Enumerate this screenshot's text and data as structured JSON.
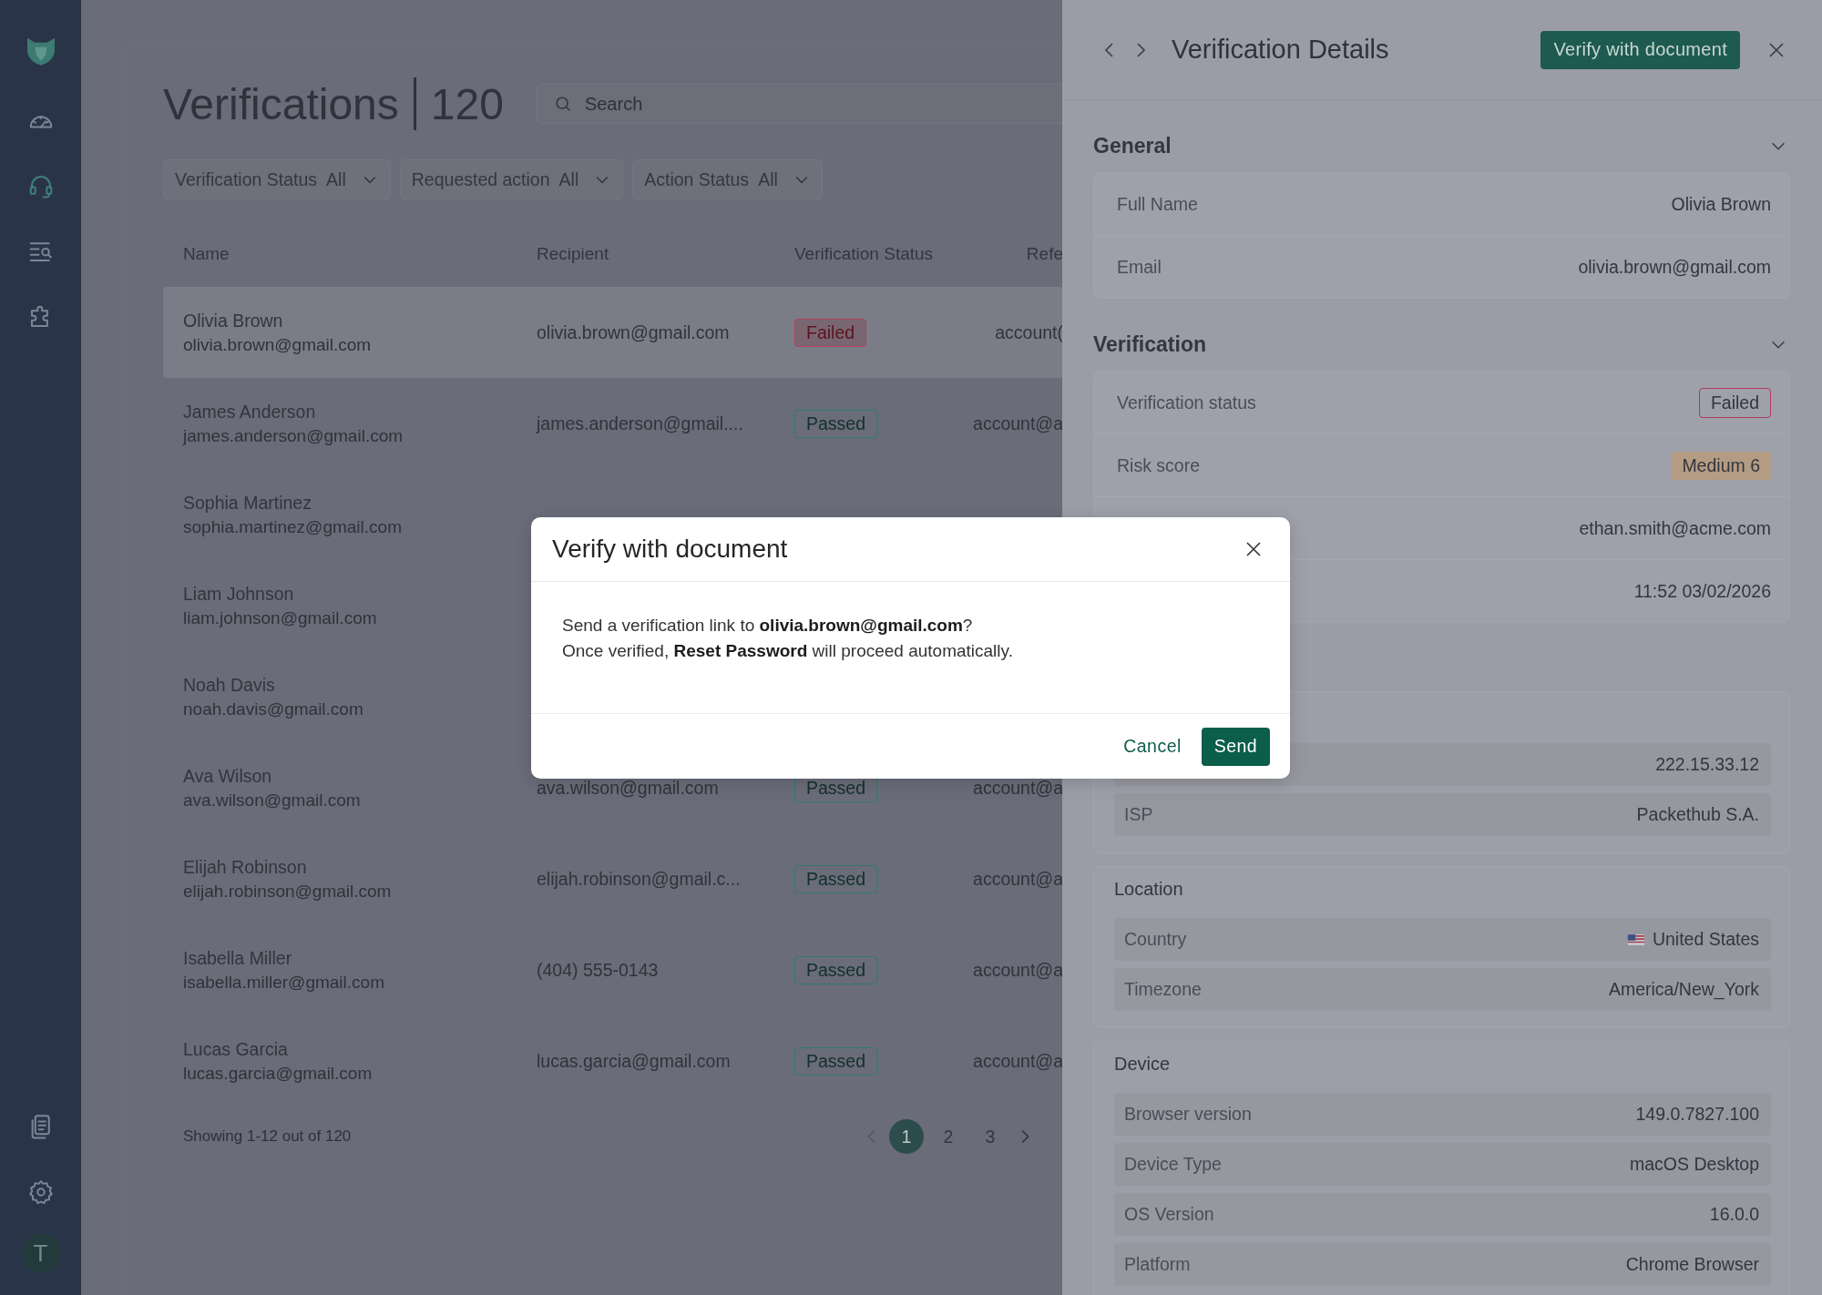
{
  "sidebar": {
    "nav_items": [
      {
        "selected": false
      },
      {
        "selected": true
      },
      {
        "selected": false
      },
      {
        "selected": false
      }
    ],
    "avatar": {
      "initial": "T"
    }
  },
  "page": {
    "title": "Verifications",
    "count": "120",
    "search": {
      "placeholder": "Search"
    }
  },
  "filters": [
    {
      "label": "Verification Status",
      "value": "All"
    },
    {
      "label": "Requested action",
      "value": "All"
    },
    {
      "label": "Action Status",
      "value": "All"
    }
  ],
  "table": {
    "columns": [
      "Name",
      "Recipient",
      "Verification Status",
      "Refe"
    ],
    "rows": [
      {
        "name": "Olivia Brown",
        "email": "olivia.brown@gmail.com",
        "recipient": "olivia.brown@gmail.com",
        "status": {
          "text": "Failed",
          "kind": "failed"
        },
        "reference": "account(",
        "selected": true
      },
      {
        "name": "James Anderson",
        "email": "james.anderson@gmail.com",
        "recipient": "james.anderson@gmail....",
        "status": {
          "text": "Passed",
          "kind": "passed"
        },
        "reference": "account@a",
        "selected": false
      },
      {
        "name": "Sophia Martinez",
        "email": "sophia.martinez@gmail.com",
        "selected": false
      },
      {
        "name": "Liam Johnson",
        "email": "liam.johnson@gmail.com",
        "selected": false
      },
      {
        "name": "Noah Davis",
        "email": "noah.davis@gmail.com",
        "selected": false
      },
      {
        "name": "Ava Wilson",
        "email": "ava.wilson@gmail.com",
        "recipient": "ava.wilson@gmail.com",
        "status": {
          "text": "Passed",
          "kind": "passed"
        },
        "reference": "account@a",
        "selected": false
      },
      {
        "name": "Elijah Robinson",
        "email": "elijah.robinson@gmail.com",
        "recipient": "elijah.robinson@gmail.c...",
        "status": {
          "text": "Passed",
          "kind": "passed"
        },
        "reference": "account@a",
        "selected": false
      },
      {
        "name": "Isabella Miller",
        "email": "isabella.miller@gmail.com",
        "recipient": "(404) 555-0143",
        "status": {
          "text": "Passed",
          "kind": "passed"
        },
        "reference": "account@a",
        "selected": false
      },
      {
        "name": "Lucas Garcia",
        "email": "lucas.garcia@gmail.com",
        "recipient": "lucas.garcia@gmail.com",
        "status": {
          "text": "Passed",
          "kind": "passed"
        },
        "reference": "account@a",
        "selected": false
      }
    ]
  },
  "pagination": {
    "summary": "Showing 1-12 out of 120",
    "pages": [
      {
        "label": "1",
        "selected": true
      },
      {
        "label": "2",
        "selected": false
      },
      {
        "label": "3",
        "selected": false
      }
    ]
  },
  "details": {
    "title": "Verification Details",
    "action": "Verify with document",
    "sections": [
      {
        "kind": "collapsible",
        "title": "General",
        "rows": [
          {
            "label": "Full Name",
            "value": "Olivia Brown",
            "kind": "text"
          },
          {
            "label": "Email",
            "value": "olivia.brown@gmail.com",
            "kind": "text"
          }
        ]
      },
      {
        "kind": "collapsible",
        "title": "Verification",
        "rows": [
          {
            "label": "Verification status",
            "value": "Failed",
            "kind": "badge-failed"
          },
          {
            "label": "Risk score",
            "value": "Medium 6",
            "kind": "badge-medium"
          },
          {
            "value": "ethan.smith@acme.com",
            "kind": "text"
          },
          {
            "value": "11:52 03/02/2026",
            "kind": "text"
          }
        ]
      },
      {
        "kind": "cards",
        "groups": [
          {
            "rows": [
              {
                "value": "222.15.33.12",
                "kind": "text"
              },
              {
                "label": "ISP",
                "value": "Packethub S.A.",
                "kind": "text"
              }
            ]
          },
          {
            "title": "Location",
            "rows": [
              {
                "label": "Country",
                "value": "United States",
                "kind": "country"
              },
              {
                "label": "Timezone",
                "value": "America/New_York",
                "kind": "text"
              }
            ]
          },
          {
            "title": "Device",
            "rows": [
              {
                "label": "Browser version",
                "value": "149.0.7827.100",
                "kind": "text"
              },
              {
                "label": "Device Type",
                "value": "macOS Desktop",
                "kind": "text"
              },
              {
                "label": "OS Version",
                "value": "16.0.0",
                "kind": "text"
              },
              {
                "label": "Platform",
                "value": "Chrome Browser",
                "kind": "text"
              }
            ]
          }
        ]
      }
    ]
  },
  "modal": {
    "title": "Verify with document",
    "lines": [
      "Send a verification link to **olivia.brown@gmail.com**?",
      "Once verified, **Reset Password** will proceed automatically."
    ],
    "buttons": [
      {
        "label": "Cancel",
        "kind": "text"
      },
      {
        "label": "Send",
        "kind": "primary"
      }
    ]
  }
}
